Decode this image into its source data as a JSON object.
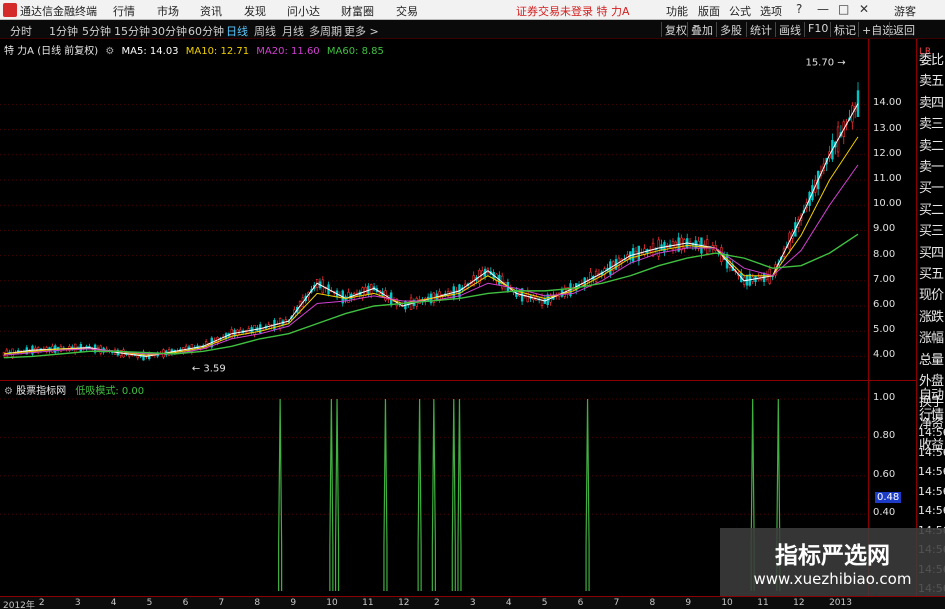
{
  "menubar": {
    "app_title": "通达信金融终端",
    "menus": [
      "行情",
      "市场",
      "资讯",
      "发现",
      "问小达",
      "财富圈",
      "交易"
    ],
    "warning": "证券交易未登录  特 力A",
    "right_items": [
      "功能",
      "版面",
      "公式",
      "选项"
    ],
    "user": "游客"
  },
  "periodbar": {
    "tabs": [
      "分时",
      "1分钟",
      "5分钟",
      "15分钟",
      "30分钟",
      "60分钟",
      "日线",
      "周线",
      "月线",
      "多周期",
      "更多 >"
    ],
    "active_tab": "日线",
    "right_buttons": [
      "复权",
      "叠加",
      "多股",
      "统计",
      "画线",
      "F10",
      "标记",
      "+自选",
      "返回"
    ]
  },
  "main_chart": {
    "stock_label": "特 力A (日线 前复权)",
    "ma": [
      {
        "label": "MA5: 14.03",
        "color": "#ffffff"
      },
      {
        "label": "MA10: 12.71",
        "color": "#f0d000"
      },
      {
        "label": "MA20: 11.60",
        "color": "#d040d0"
      },
      {
        "label": "MA60: 8.85",
        "color": "#40c040"
      }
    ],
    "high_label": "15.70",
    "low_label": "3.59"
  },
  "indicator": {
    "name": "股票指标网",
    "mode_label": "低吸模式: 0.00",
    "current_value": "0.48"
  },
  "side_panel": {
    "items": [
      "委比",
      "卖五",
      "卖四",
      "卖三",
      "卖二",
      "卖一",
      "买一",
      "买二",
      "买三",
      "买四",
      "买五",
      "现价",
      "涨跌",
      "涨幅",
      "总量",
      "外盘",
      "换手",
      "净资",
      "收益"
    ],
    "bottom_items": [
      "自动",
      "行情"
    ],
    "times": [
      "14:56",
      "14:56",
      "14:56",
      "14:56",
      "14:56",
      "14:56",
      "14:56",
      "14:56",
      "14:56"
    ]
  },
  "date_axis": {
    "ticks": [
      "2012年",
      "2",
      "3",
      "4",
      "5",
      "6",
      "7",
      "8",
      "9",
      "10",
      "11",
      "12",
      "2",
      "3",
      "4",
      "5",
      "6",
      "7",
      "8",
      "9",
      "10",
      "11",
      "12",
      "2013"
    ]
  },
  "watermark": {
    "title": "指标严选网",
    "url": "www.xuezhibiao.com"
  },
  "colors": {
    "background": "#000000",
    "up": "#ff3030",
    "down": "#00c8c8",
    "signal": "#40b040"
  },
  "chart_data": [
    {
      "type": "line",
      "title": "特 力A (日线 前复权)",
      "xlabel": "",
      "ylabel": "",
      "ylim": [
        3.5,
        16.0
      ],
      "y_ticks": [
        4.0,
        5.0,
        6.0,
        7.0,
        8.0,
        9.0,
        10.0,
        11.0,
        12.0,
        13.0,
        14.0
      ],
      "x": [
        0,
        10,
        20,
        30,
        40,
        50,
        60,
        70,
        80,
        90,
        100,
        110,
        120,
        130,
        140,
        150,
        160,
        170,
        180,
        190,
        200,
        210,
        220,
        230,
        240,
        250,
        260,
        270,
        280,
        290,
        300
      ],
      "series": [
        {
          "name": "MA5",
          "values": [
            4.1,
            4.25,
            4.3,
            4.35,
            4.15,
            4.0,
            4.2,
            4.4,
            4.9,
            5.1,
            5.4,
            6.9,
            6.3,
            6.7,
            6.0,
            6.3,
            6.6,
            7.4,
            6.5,
            6.2,
            6.7,
            7.3,
            8.0,
            8.3,
            8.5,
            8.3,
            7.0,
            7.2,
            9.5,
            12.0,
            14.03
          ]
        },
        {
          "name": "MA10",
          "values": [
            4.1,
            4.2,
            4.3,
            4.3,
            4.2,
            4.05,
            4.15,
            4.35,
            4.8,
            5.0,
            5.3,
            6.5,
            6.3,
            6.5,
            6.1,
            6.3,
            6.5,
            7.2,
            6.6,
            6.3,
            6.6,
            7.2,
            7.9,
            8.2,
            8.4,
            8.3,
            7.2,
            7.2,
            8.8,
            11.0,
            12.71
          ]
        },
        {
          "name": "MA20",
          "values": [
            4.05,
            4.15,
            4.25,
            4.3,
            4.2,
            4.1,
            4.1,
            4.3,
            4.7,
            4.9,
            5.2,
            6.1,
            6.2,
            6.4,
            6.2,
            6.2,
            6.4,
            6.9,
            6.7,
            6.4,
            6.5,
            7.0,
            7.7,
            8.1,
            8.3,
            8.3,
            7.5,
            7.2,
            8.2,
            10.0,
            11.6
          ]
        },
        {
          "name": "MA60",
          "values": [
            3.95,
            4.0,
            4.1,
            4.2,
            4.2,
            4.15,
            4.1,
            4.2,
            4.4,
            4.7,
            4.9,
            5.3,
            5.7,
            6.0,
            6.1,
            6.2,
            6.3,
            6.5,
            6.6,
            6.6,
            6.7,
            6.9,
            7.2,
            7.6,
            7.9,
            8.1,
            7.9,
            7.5,
            7.6,
            8.1,
            8.85
          ]
        }
      ]
    },
    {
      "type": "bar",
      "title": "股票指标网",
      "ylim": [
        0,
        1.0
      ],
      "y_ticks": [
        0.4,
        0.6,
        0.8,
        1.0
      ],
      "x": [
        97,
        115,
        117,
        134,
        146,
        151,
        158,
        160,
        205,
        263,
        272
      ],
      "values": [
        1.0,
        1.0,
        1.0,
        1.0,
        1.0,
        1.0,
        1.0,
        1.0,
        1.0,
        1.0,
        1.0
      ]
    }
  ]
}
